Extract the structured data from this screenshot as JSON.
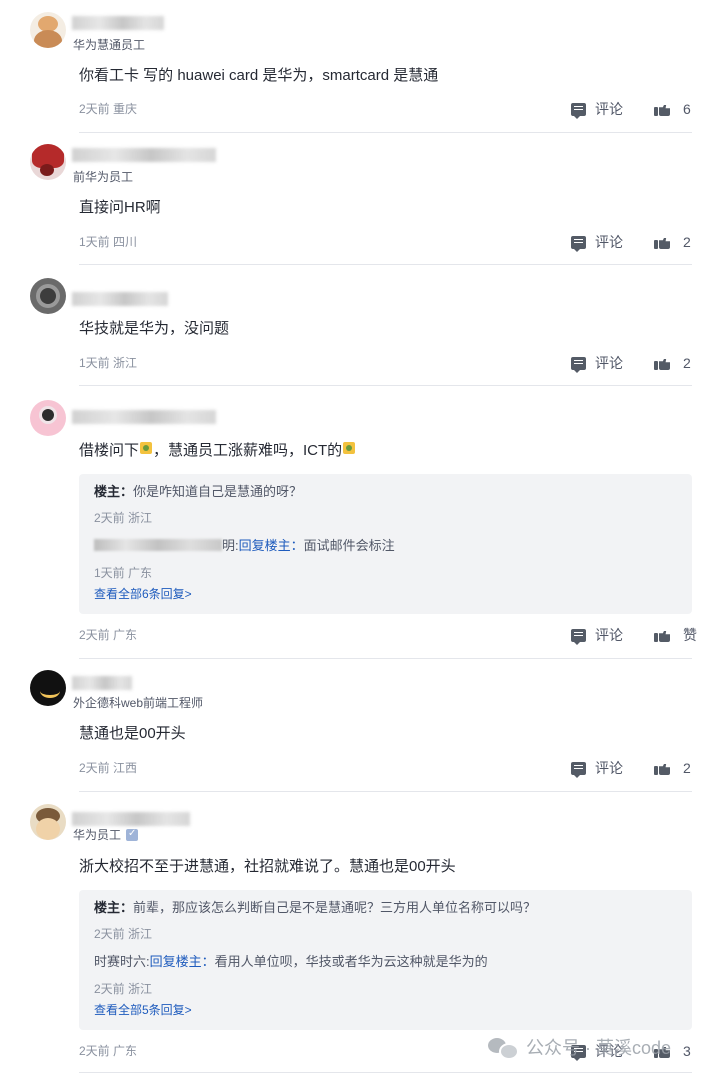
{
  "labels": {
    "comment": "评论",
    "reply_to_op": "回复楼主："
  },
  "comments": [
    {
      "subtitle": "华为慧通员工",
      "content": "你看工卡 写的 huawei card 是华为，smartcard 是慧通",
      "time": "2天前",
      "location": "重庆",
      "likes": "6"
    },
    {
      "subtitle": "前华为员工",
      "content": "直接问HR啊",
      "time": "1天前",
      "location": "四川",
      "likes": "2"
    },
    {
      "subtitle": "",
      "content": "华技就是华为，没问题",
      "time": "1天前",
      "location": "浙江",
      "likes": "2"
    },
    {
      "subtitle": "",
      "content_before": "借楼问下",
      "content_middle": "，慧通员工涨薪难吗，ICT的",
      "time": "2天前",
      "location": "广东",
      "likes": "赞",
      "replies": [
        {
          "who": "楼主：",
          "text": "你是咋知道自己是慧通的呀？",
          "time": "2天前",
          "location": "浙江"
        },
        {
          "who_tail": "明:",
          "text": "面试邮件会标注",
          "time": "1天前",
          "location": "广东"
        }
      ],
      "view_all": "查看全部6条回复>"
    },
    {
      "subtitle": "外企德科web前端工程师",
      "content": "慧通也是00开头",
      "time": "2天前",
      "location": "江西",
      "likes": "2"
    },
    {
      "subtitle": "华为员工",
      "content": "浙大校招不至于进慧通，社招就难说了。慧通也是00开头",
      "time": "2天前",
      "location": "广东",
      "likes": "3",
      "replies": [
        {
          "who": "楼主：",
          "text": "前辈，那应该怎么判断自己是不是慧通呢？三方用人单位名称可以吗？",
          "time": "2天前",
          "location": "浙江"
        },
        {
          "who_tail": "时赛时六:",
          "text": "看用人单位呗，华技或者华为云这种就是华为的",
          "time": "2天前",
          "location": "浙江"
        }
      ],
      "view_all": "查看全部5条回复>"
    }
  ],
  "watermark": {
    "text": "公众号 · 莫溪code"
  },
  "colors": {
    "link": "#1e5bbd",
    "reply_bg": "#f2f3f5",
    "meta": "#8a919f",
    "divider": "#e4e6eb"
  }
}
